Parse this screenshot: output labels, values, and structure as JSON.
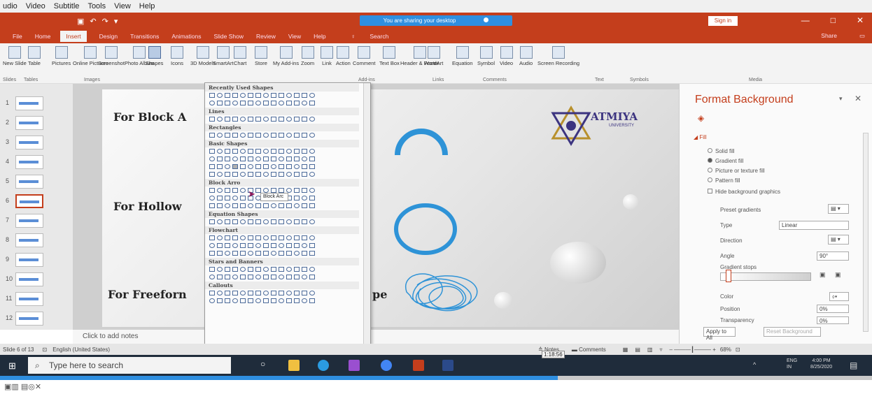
{
  "menubar": [
    "udio",
    "Video",
    "Subtitle",
    "Tools",
    "View",
    "Help"
  ],
  "titlebar": {
    "sharing": "You are sharing your desktop",
    "signin": "Sign in",
    "controls": [
      "—",
      "□",
      "✕"
    ]
  },
  "tabs": {
    "items": [
      "File",
      "Home",
      "Insert",
      "Design",
      "Transitions",
      "Animations",
      "Slide Show",
      "Review",
      "View",
      "Help",
      "Search"
    ],
    "share": "Share"
  },
  "ribbon": {
    "buttons": [
      "New Slide",
      "Table",
      "Pictures",
      "Online Pictures",
      "Screenshot",
      "Photo Album",
      "Shapes",
      "Icons",
      "3D Models",
      "SmartArt",
      "Chart",
      "Store",
      "My Add-ins",
      "Zoom",
      "Link",
      "Action",
      "Comment",
      "Text Box",
      "Header & Footer",
      "WordArt",
      "Equation",
      "Symbol",
      "Video",
      "Audio",
      "Screen Recording"
    ],
    "groups": [
      "Slides",
      "Tables",
      "Images",
      "Add-ins",
      "Links",
      "Comments",
      "Text",
      "Symbols",
      "Media"
    ]
  },
  "thumbnails": [
    "1",
    "2",
    "3",
    "4",
    "5",
    "6",
    "7",
    "8",
    "9",
    "10",
    "11",
    "12"
  ],
  "slide": {
    "lines": [
      "For Block A",
      "For Hollow",
      "For Freeforn",
      "pe"
    ],
    "logo": {
      "name": "ATMIYA",
      "sub": "UNIVERSITY"
    },
    "notes": "Click to add notes"
  },
  "gallery": {
    "sections": [
      "Recently Used Shapes",
      "Lines",
      "Rectangles",
      "Basic Shapes",
      "Block Arro",
      "Equation Shapes",
      "Flowchart",
      "Stars and Banners",
      "Callouts"
    ],
    "tooltip": "Block Arc"
  },
  "format_pane": {
    "title": "Format Background",
    "fill_header": "Fill",
    "options": [
      "Solid fill",
      "Gradient fill",
      "Picture or texture fill",
      "Pattern fill",
      "Hide background graphics"
    ],
    "selected_option": "Gradient fill",
    "labels": [
      "Preset gradients",
      "Type",
      "Direction",
      "Angle",
      "Gradient stops",
      "Color",
      "Position",
      "Transparency"
    ],
    "type_value": "Linear",
    "angle_value": "90°",
    "position_value": "0%",
    "transparency_value": "0%",
    "apply_all": "Apply to All",
    "reset": "Reset Background"
  },
  "statusbar": {
    "slide_info": "Slide 6 of 13",
    "language": "English (United States)",
    "notes": "Notes",
    "comments": "Comments",
    "zoom": "68%"
  },
  "taskbar": {
    "search_placeholder": "Type here to search",
    "lang": "ENG",
    "region": "IN",
    "time": "4:00 PM",
    "date": "8/25/2020",
    "timestamp": "1:18:56"
  },
  "playback_progress": 0.64,
  "colors": {
    "accent": "#c43e1c",
    "share": "#2f8fe0",
    "shape_blue": "#2e93d7"
  }
}
